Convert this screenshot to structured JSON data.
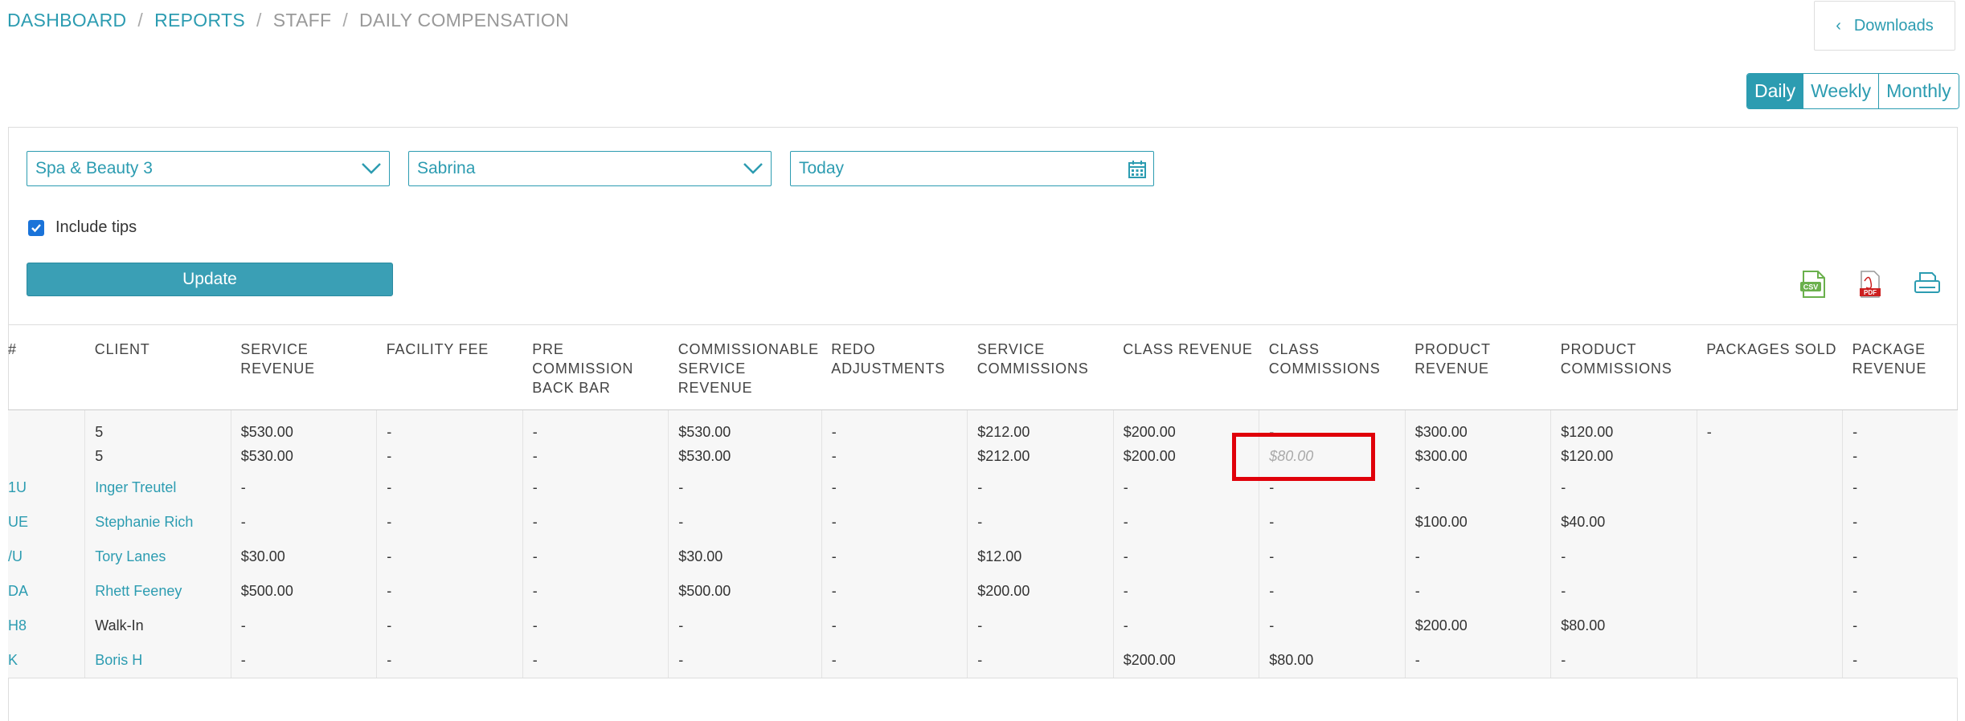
{
  "breadcrumb": {
    "dashboard": "DASHBOARD",
    "reports": "REPORTS",
    "staff": "STAFF",
    "current": "DAILY COMPENSATION",
    "separator": "/"
  },
  "downloads": {
    "label": "Downloads",
    "icon": "chevron-left-icon"
  },
  "period": {
    "daily": "Daily",
    "weekly": "Weekly",
    "monthly": "Monthly",
    "active": "Daily"
  },
  "filters": {
    "location": "Spa & Beauty 3",
    "staff": "Sabrina",
    "date": "Today"
  },
  "include_tips": {
    "label": "Include tips",
    "checked": true
  },
  "update_label": "Update",
  "export": {
    "csv": "CSV",
    "pdf": "PDF",
    "print": "print-icon"
  },
  "table": {
    "headers": [
      "#",
      "CLIENT",
      "SERVICE REVENUE",
      "FACILITY FEE",
      "PRE COMMISSION BACK BAR",
      "COMMISSIONABLE SERVICE REVENUE",
      "REDO ADJUSTMENTS",
      "SERVICE COMMISSIONS",
      "CLASS REVENUE",
      "CLASS COMMISSIONS",
      "PRODUCT REVENUE",
      "PRODUCT COMMISSIONS",
      "PACKAGES SOLD",
      "PACKAGE REVENUE"
    ],
    "summary_rows": [
      [
        "",
        "5",
        "$530.00",
        "-",
        "-",
        "$530.00",
        "-",
        "$212.00",
        "$200.00",
        "-",
        "$300.00",
        "$120.00",
        "-",
        "-"
      ],
      [
        "",
        "5",
        "$530.00",
        "-",
        "-",
        "$530.00",
        "-",
        "$212.00",
        "$200.00",
        "$80.00",
        "$300.00",
        "$120.00",
        "",
        "-"
      ]
    ],
    "rows": [
      [
        "1U",
        "Inger Treutel",
        "-",
        "-",
        "-",
        "-",
        "-",
        "-",
        "-",
        "-",
        "-",
        "-",
        "",
        "-"
      ],
      [
        "UE",
        "Stephanie Rich",
        "-",
        "-",
        "-",
        "-",
        "-",
        "-",
        "-",
        "-",
        "$100.00",
        "$40.00",
        "",
        "-"
      ],
      [
        "/U",
        "Tory Lanes",
        "$30.00",
        "-",
        "-",
        "$30.00",
        "-",
        "$12.00",
        "-",
        "-",
        "-",
        "-",
        "",
        "-"
      ],
      [
        "DA",
        "Rhett Feeney",
        "$500.00",
        "-",
        "-",
        "$500.00",
        "-",
        "$200.00",
        "-",
        "-",
        "-",
        "-",
        "",
        "-"
      ],
      [
        "H8",
        "Walk-In",
        "-",
        "-",
        "-",
        "-",
        "-",
        "-",
        "-",
        "-",
        "$200.00",
        "$80.00",
        "",
        "-"
      ],
      [
        "K",
        "Boris H",
        "-",
        "-",
        "-",
        "-",
        "-",
        "-",
        "$200.00",
        "$80.00",
        "-",
        "-",
        "",
        "-"
      ]
    ],
    "linked_clients": [
      "Inger Treutel",
      "Stephanie Rich",
      "Tory Lanes",
      "Rhett Feeney",
      "Boris H"
    ]
  },
  "colors": {
    "accent": "#2c9cb1",
    "highlight": "#e0000a",
    "csv": "#6ab04c",
    "pdf": "#cc1f1f"
  }
}
